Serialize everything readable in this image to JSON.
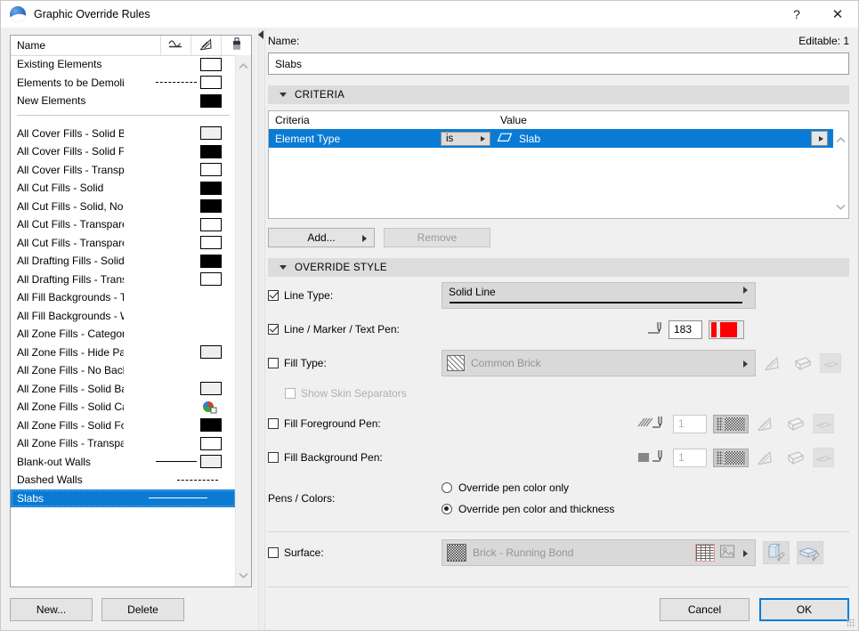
{
  "window": {
    "title": "Graphic Override Rules",
    "app_icon": "archicad-logo-icon",
    "help_label": "?",
    "close_label": "✕"
  },
  "rules_list": {
    "columns": [
      {
        "label": "Name",
        "icon": "name-column"
      },
      {
        "label": "",
        "icon": "line-type-column-icon"
      },
      {
        "label": "",
        "icon": "fill-type-column-icon"
      },
      {
        "label": "",
        "icon": "surface-column-icon"
      }
    ],
    "items": [
      {
        "label": "Existing Elements",
        "line": "none",
        "swatch": "white"
      },
      {
        "label": "Elements to be Demolished",
        "line": "dashed",
        "swatch": "white"
      },
      {
        "label": "New Elements",
        "line": "none",
        "swatch": "black"
      },
      {
        "label": "",
        "separator": true
      },
      {
        "label": "All Cover Fills - Solid Backgr...",
        "line": "none",
        "swatch": "gray"
      },
      {
        "label": "All Cover Fills - Solid Foregr...",
        "line": "none",
        "swatch": "black"
      },
      {
        "label": "All Cover Fills - Transparent",
        "line": "none",
        "swatch": "white"
      },
      {
        "label": "All Cut Fills - Solid",
        "line": "none",
        "swatch": "black"
      },
      {
        "label": "All Cut Fills - Solid, No Skin ...",
        "line": "none",
        "swatch": "black"
      },
      {
        "label": "All Cut Fills - Transparent",
        "line": "none",
        "swatch": "white"
      },
      {
        "label": "All Cut Fills - Transparent, N...",
        "line": "none",
        "swatch": "white"
      },
      {
        "label": "All Drafting Fills - Solid",
        "line": "none",
        "swatch": "black"
      },
      {
        "label": "All Drafting Fills - Transparent",
        "line": "none",
        "swatch": "white"
      },
      {
        "label": "All Fill Backgrounds - Transp...",
        "line": "none",
        "swatch": "none"
      },
      {
        "label": "All Fill Backgrounds - Windo...",
        "line": "none",
        "swatch": "none"
      },
      {
        "label": "All Zone Fills - Category Back...",
        "line": "none",
        "swatch": "none"
      },
      {
        "label": "All Zone Fills - Hide Pattern",
        "line": "none",
        "swatch": "gray"
      },
      {
        "label": "All Zone Fills - No Background",
        "line": "none",
        "swatch": "none"
      },
      {
        "label": "All Zone Fills - Solid Backgro...",
        "line": "none",
        "swatch": "gray"
      },
      {
        "label": "All Zone Fills - Solid Category",
        "line": "none",
        "swatch": "category"
      },
      {
        "label": "All Zone Fills - Solid Foregro...",
        "line": "none",
        "swatch": "black"
      },
      {
        "label": "All Zone Fills - Transparent",
        "line": "none",
        "swatch": "white"
      },
      {
        "label": "Blank-out Walls",
        "line": "solid",
        "swatch": "gray"
      },
      {
        "label": "Dashed Walls",
        "line": "dashed",
        "swatch": "none"
      },
      {
        "label": "Slabs",
        "line": "solid",
        "swatch": "none",
        "selected": true
      }
    ],
    "new_button": "New...",
    "delete_button": "Delete"
  },
  "details": {
    "name_label": "Name:",
    "editable_label": "Editable: 1",
    "name_value": "Slabs",
    "criteria_section": {
      "title": "CRITERIA",
      "columns": [
        "Criteria",
        "",
        "Value"
      ],
      "rows": [
        {
          "criteria": "Element Type",
          "operator": "is",
          "value": "Slab",
          "value_icon": "slab-icon",
          "selected": true
        }
      ],
      "add_button": "Add...",
      "remove_button": "Remove"
    },
    "override_section": {
      "title": "OVERRIDE STYLE",
      "line_type": {
        "label": "Line Type:",
        "checked": true,
        "value": "Solid Line"
      },
      "line_marker_text_pen": {
        "label": "Line / Marker / Text Pen:",
        "checked": true,
        "pen_number": "183",
        "pen_color": "#ff0000",
        "pen_icon": "pen-weight-icon"
      },
      "fill_type": {
        "label": "Fill Type:",
        "checked": false,
        "value": "Common Brick",
        "pattern_icon": "diagonal-hatch-icon",
        "buttons": [
          "cut-fill-icon",
          "cover-fill-icon",
          "drafting-fill-icon"
        ]
      },
      "show_skin_separators": {
        "label": "Show Skin Separators",
        "checked": false
      },
      "fill_foreground_pen": {
        "label": "Fill Foreground Pen:",
        "checked": false,
        "pen_number": "1",
        "swatch_icon": "hatch-swatch-icon",
        "pattern_icon": "checker-pattern-icon",
        "buttons": [
          "cut-fill-icon",
          "cover-fill-icon",
          "drafting-fill-icon"
        ]
      },
      "fill_background_pen": {
        "label": "Fill Background Pen:",
        "checked": false,
        "pen_number": "1",
        "swatch_icon": "solid-gray-swatch-icon",
        "pattern_icon": "checker-pattern-icon",
        "buttons": [
          "cut-fill-icon",
          "cover-fill-icon",
          "drafting-fill-icon"
        ]
      },
      "pens_colors": {
        "label": "Pens / Colors:",
        "options": [
          {
            "label": "Override pen color only",
            "selected": false
          },
          {
            "label": "Override pen color and thickness",
            "selected": true
          }
        ]
      },
      "surface": {
        "label": "Surface:",
        "checked": false,
        "value": "Brick - Running Bond",
        "swatch_icon": "checker-surface-icon",
        "buttons": [
          "brick-texture-icon",
          "picture-icon",
          "paint-3d-icon",
          "paint-side-icon"
        ]
      }
    }
  },
  "footer": {
    "cancel_label": "Cancel",
    "ok_label": "OK"
  }
}
